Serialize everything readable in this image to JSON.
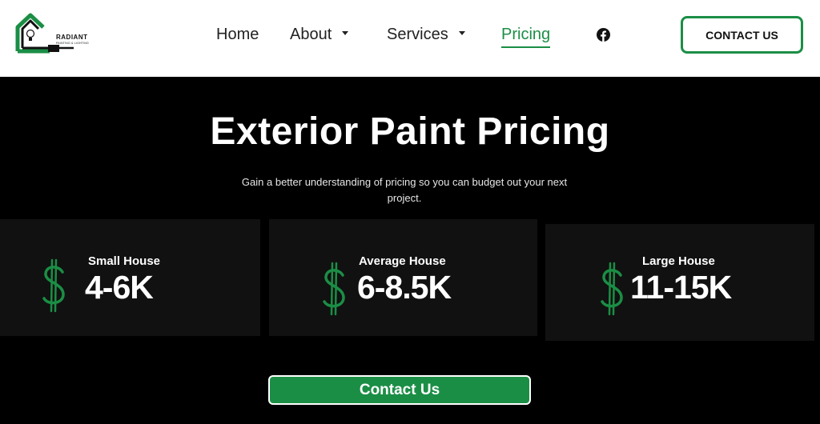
{
  "brand": {
    "name": "RADIANT",
    "tagline": "PAINTING & LIGHTING",
    "accent_color": "#1b8e45"
  },
  "nav": {
    "items": [
      {
        "label": "Home",
        "has_dropdown": false,
        "active": false
      },
      {
        "label": "About",
        "has_dropdown": true,
        "active": false
      },
      {
        "label": "Services",
        "has_dropdown": true,
        "active": false
      },
      {
        "label": "Pricing",
        "has_dropdown": false,
        "active": true
      }
    ],
    "social_icon": "facebook-icon",
    "cta_label": "CONTACT US"
  },
  "hero": {
    "title": "Exterior Paint Pricing",
    "subtitle": "Gain a better understanding of pricing so you can budget out your next project."
  },
  "cards": [
    {
      "label": "Small House",
      "price": "4-6K",
      "icon": "dollar-sign-icon"
    },
    {
      "label": "Average House",
      "price": "6-8.5K",
      "icon": "dollar-sign-icon"
    },
    {
      "label": "Large House",
      "price": "11-15K",
      "icon": "dollar-sign-icon"
    }
  ],
  "cta": {
    "label": "Contact Us"
  }
}
